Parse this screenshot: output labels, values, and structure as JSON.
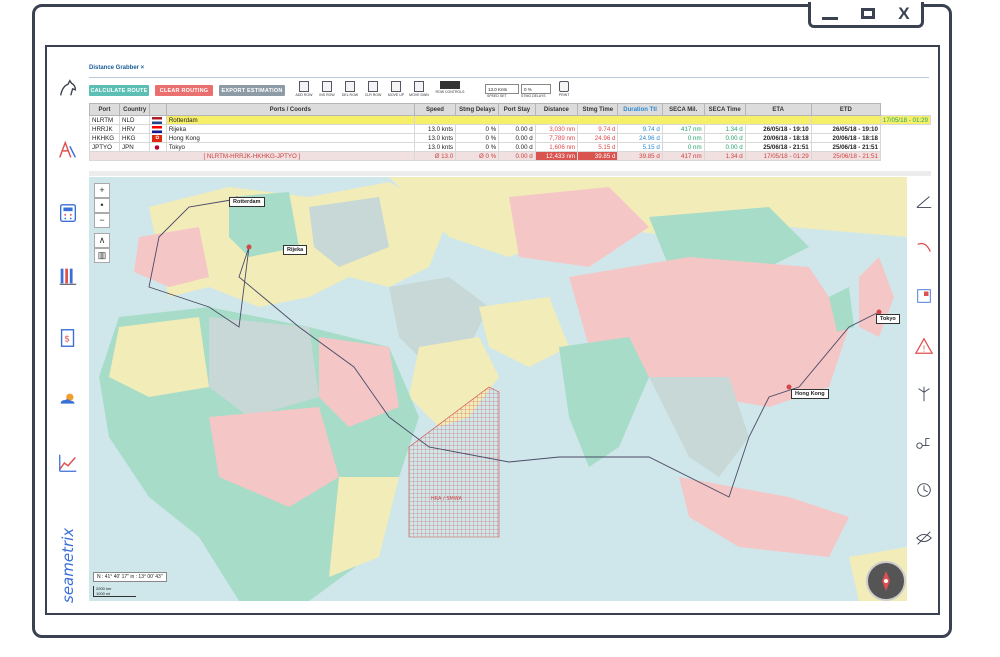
{
  "window": {
    "min": "",
    "max": "",
    "close": "X"
  },
  "tab": {
    "label": "Distance Grabber ×"
  },
  "toolbar": {
    "calculate": "CALCULATE ROUTE",
    "clear": "CLEAR ROUTING",
    "export": "EXPORT ESTIMATION",
    "icons": [
      "ADD ROW",
      "INS ROW",
      "DEL ROW",
      "CLR ROW",
      "MOVE UP",
      "MOVE DWN",
      "ROW CONTROLS"
    ],
    "speed_value": "13.0 Knts",
    "speed_label": "SPEED SET",
    "delay_value": "0 %",
    "delay_label": "STMG DELAYS",
    "print_label": "PRINT"
  },
  "table": {
    "headers": [
      "Port",
      "Country",
      "",
      "Ports / Coords",
      "Speed",
      "Stmg Delays",
      "Port Stay",
      "Distance",
      "Stmg Time",
      "Duration Ttl",
      "SECA Mil.",
      "SECA Time",
      "ETA",
      "ETD"
    ],
    "rows": [
      {
        "port": "NLRTM",
        "country": "NLD",
        "flag": "NL",
        "name": "Rotterdam",
        "speed": "",
        "delays": "",
        "stay": "",
        "distance": "",
        "stmg": "",
        "dur": "",
        "seca": "",
        "secat": "",
        "eta": "",
        "etd": "17/05/18 - 01:29"
      },
      {
        "port": "HRRJK",
        "country": "HRV",
        "flag": "HR",
        "name": "Rijeka",
        "speed": "13.0 knts",
        "delays": "0 %",
        "stay": "0.00 d",
        "distance": "3,030 nm",
        "stmg": "9.74 d",
        "dur": "9.74 d",
        "seca": "417 nm",
        "secat": "1.34 d",
        "eta": "26/05/18 - 19:10",
        "etd": "26/05/18 - 19:10"
      },
      {
        "port": "HKHKG",
        "country": "HKG",
        "flag": "HK",
        "name": "Hong Kong",
        "speed": "13.0 knts",
        "delays": "0 %",
        "stay": "0.00 d",
        "distance": "7,789 nm",
        "stmg": "24.96 d",
        "dur": "24.96 d",
        "seca": "0 nm",
        "secat": "0.00 d",
        "eta": "20/06/18 - 18:18",
        "etd": "20/06/18 - 18:18"
      },
      {
        "port": "JPTYO",
        "country": "JPN",
        "flag": "JP",
        "name": "Tokyo",
        "speed": "13.0 knts",
        "delays": "0 %",
        "stay": "0.00 d",
        "distance": "1,606 nm",
        "stmg": "5.15 d",
        "dur": "5.15 d",
        "seca": "0 nm",
        "secat": "0.00 d",
        "eta": "25/06/18 - 21:51",
        "etd": "25/06/18 - 21:51"
      }
    ],
    "summary": {
      "route": "[ NLRTM-HRRJK-HKHKG-JPTYO ]",
      "speed": "Ø 13.0",
      "delays": "Ø 0 %",
      "stay": "0.00 d",
      "distance": "12,433 nm",
      "stmg": "39.85 d",
      "dur": "39.85 d",
      "seca": "417 nm",
      "secat": "1.34 d",
      "eta": "17/05/18 - 01:29",
      "etd": "25/06/18 - 21:51"
    }
  },
  "map": {
    "ports": [
      "Rotterdam",
      "Rijeka",
      "Hong Kong",
      "Tokyo"
    ],
    "hra": "HRA / SMWA",
    "coord": "N : 41° 40' 17\" in : 13° 00' 43\"",
    "scale_km": "2000 km",
    "scale_mi": "1000 mi",
    "zoom_in": "+",
    "zoom_mid": "•",
    "zoom_out": "−"
  },
  "brand": {
    "name": "seametrix"
  },
  "colors": {
    "calculate": "#5bbfb6",
    "clear": "#ea6f6f",
    "export": "#8d9ba6",
    "water": "#cfe7ea",
    "route": "#4a4a66",
    "hra": "#d04a4a"
  }
}
